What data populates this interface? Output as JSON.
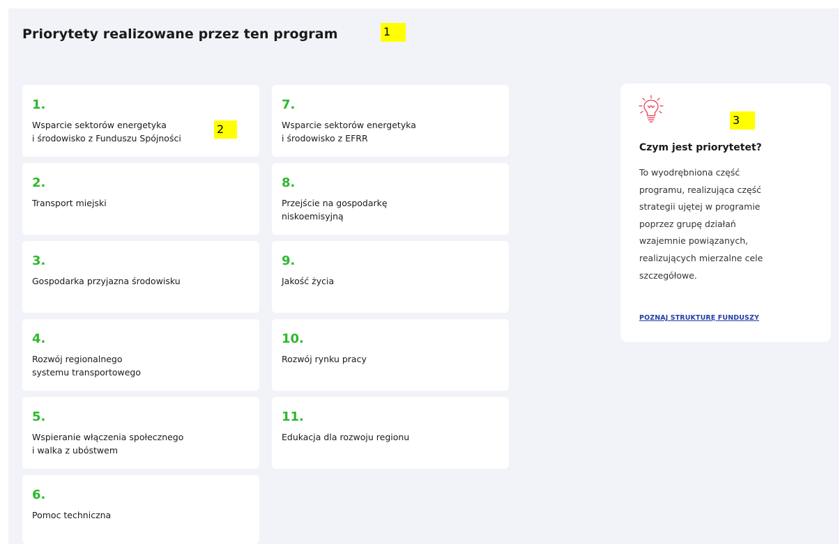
{
  "section": {
    "title": "Priorytety realizowane przez ten program"
  },
  "markers": [
    "1",
    "2",
    "3"
  ],
  "priorities": [
    {
      "number": "1.",
      "label": "Wsparcie sektorów energetyka\ni środowisko z Funduszu Spójności"
    },
    {
      "number": "2.",
      "label": "Transport miejski"
    },
    {
      "number": "3.",
      "label": "Gospodarka przyjazna środowisku"
    },
    {
      "number": "4.",
      "label": "Rozwój regionalnego\nsystemu transportowego"
    },
    {
      "number": "5.",
      "label": "Wspieranie włączenia społecznego\n i walka z ubóstwem"
    },
    {
      "number": "6.",
      "label": "Pomoc techniczna"
    },
    {
      "number": "7.",
      "label": "Wsparcie sektorów energetyka\ni środowisko z EFRR"
    },
    {
      "number": "8.",
      "label": "Przejście na gospodarkę\nniskoemisyjną"
    },
    {
      "number": "9.",
      "label": "Jakość życia"
    },
    {
      "number": "10.",
      "label": "Rozwój rynku pracy"
    },
    {
      "number": "11.",
      "label": "Edukacja dla rozwoju regionu"
    }
  ],
  "info": {
    "icon": "lightbulb-icon",
    "heading": "Czym jest priorytetet?",
    "description": "To wyodrębniona część programu, realizująca część strategii ujętej w programie poprzez grupę działań wzajemnie powiązanych, realizujących mierzalne cele szczegółowe.",
    "link": "POZNAJ STRUKTURĘ FUNDUSZY"
  },
  "colors": {
    "number_green": "#2db82d",
    "background": "#f2f3f8",
    "link_blue": "#1f3fa8",
    "icon_red": "#e8334a",
    "marker_yellow": "#ffff00"
  }
}
